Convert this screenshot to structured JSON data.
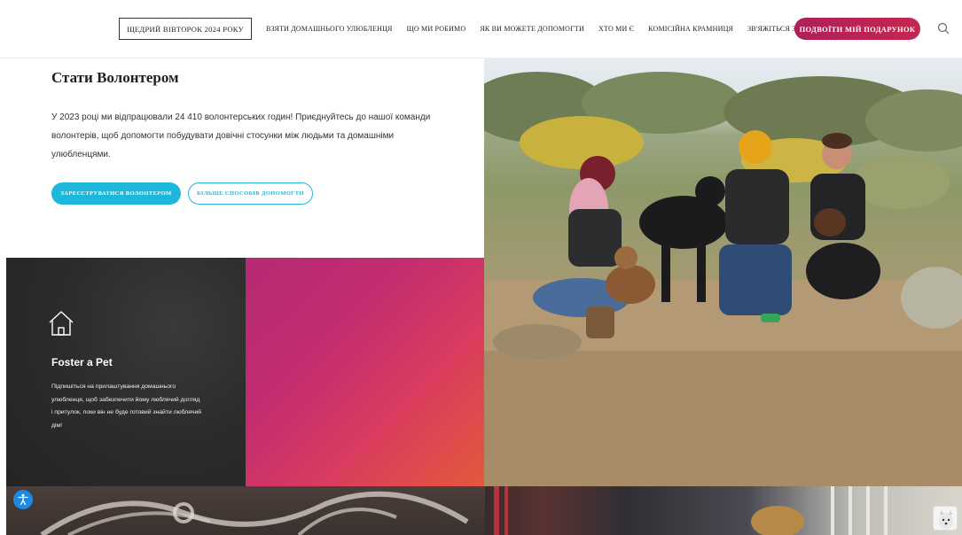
{
  "nav": {
    "giving_tuesday": "ЩЕДРИЙ ВІВТОРОК 2024 РОКУ",
    "links": [
      "ВЗЯТИ ДОМАШНЬОГО УЛЮБЛЕНЦЯ",
      "ЩО МИ РОБИМО",
      "ЯК ВИ МОЖЕТЕ ДОПОМОГТИ",
      "ХТО МИ Є",
      "КОМІСІЙНА КРАМНИЦЯ",
      "ЗВ'ЯЖІТЬСЯ З НАМИ"
    ],
    "cta": "ПОДВОЇТИ МІЙ ПОДАРУНОК",
    "search_icon": "search-icon"
  },
  "hero": {
    "title": "Стати Волонтером",
    "body": "У 2023 році ми відпрацювали 24 410 волонтерських годин! Приєднуйтесь до нашої команди волонтерів, щоб допомогти побудувати довічні стосунки між людьми та домашніми улюбленцями.",
    "primary_button": "ЗАРЕЄСТРУВАТИСЯ ВОЛОНТЕРОМ",
    "secondary_button": "БІЛЬШЕ СПОСОБІВ ДОПОМОГТИ"
  },
  "foster_card": {
    "icon": "house-icon",
    "title": "Foster a Pet",
    "body": "Підпишіться на прилаштування домашнього улюбленця, щоб забезпечити йому люблячий догляд і притулок, поки він не буде готовий знайти люблячий дім!"
  },
  "colors": {
    "accent_cyan": "#1eb7dc",
    "cta_magenta": "#b01f5a",
    "dark_card": "#2b2b2b"
  },
  "widgets": {
    "accessibility_icon": "accessibility-icon",
    "chat_icon": "chat-avatar-icon"
  }
}
